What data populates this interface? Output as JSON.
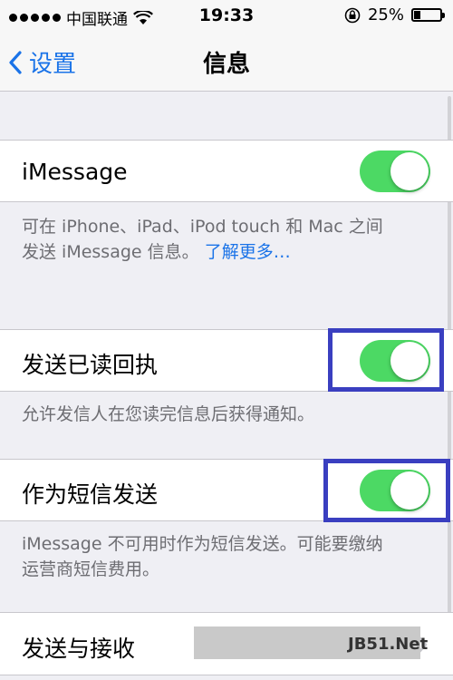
{
  "status_bar": {
    "carrier": "中国联通",
    "time": "19:33",
    "battery": "25%",
    "battery_level": 0.25
  },
  "nav": {
    "back_label": "设置",
    "title": "信息"
  },
  "imessage": {
    "label": "iMessage",
    "enabled": true,
    "footnote_line1": "可在 iPhone、iPad、iPod touch 和 Mac 之间",
    "footnote_line2": "发送 iMessage 信息。",
    "learn_more": "了解更多…"
  },
  "read_receipts": {
    "label": "发送已读回执",
    "enabled": true,
    "footnote": "允许发信人在您读完信息后获得通知。"
  },
  "send_as_sms": {
    "label": "作为短信发送",
    "enabled": true,
    "footnote_line1": "iMessage 不可用时作为短信发送。可能要缴纳",
    "footnote_line2": "运营商短信费用。"
  },
  "send_receive": {
    "label": "发送与接收"
  },
  "watermark": {
    "text": "JB51.Net"
  },
  "colors": {
    "accent": "#1a73e8",
    "toggle_on": "#4cd964",
    "highlight": "#3a3fc0"
  }
}
